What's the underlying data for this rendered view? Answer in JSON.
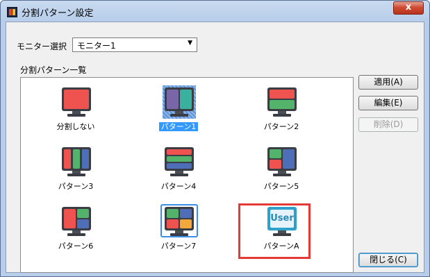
{
  "window": {
    "title": "分割パターン設定",
    "close_glyph": "x"
  },
  "monitor_select": {
    "label": "モニター選択",
    "value": "モニター1"
  },
  "pattern_list": {
    "label": "分割パターン一覧",
    "items": [
      {
        "label": "分割しない"
      },
      {
        "label": "パターン1"
      },
      {
        "label": "パターン2"
      },
      {
        "label": "パターン3"
      },
      {
        "label": "パターン4"
      },
      {
        "label": "パターン5"
      },
      {
        "label": "パターン6"
      },
      {
        "label": "パターン7"
      },
      {
        "label": "パターンA",
        "icon_text": "User"
      }
    ],
    "selected_index": 1
  },
  "buttons": {
    "apply": "適用(A)",
    "edit": "編集(E)",
    "delete": "削除(D)",
    "close": "閉じる(C)"
  },
  "colors": {
    "red": "#ef5350",
    "teal": "#3ab09e",
    "purple": "#7866a8",
    "blue": "#4e6fb8",
    "green": "#54b36a",
    "orange": "#f2a83a",
    "highlight": "#e53935",
    "selection": "#3399ff"
  },
  "icons": [
    "monitor-icon",
    "user-layout-icon",
    "chevron-down-icon",
    "close-icon"
  ]
}
